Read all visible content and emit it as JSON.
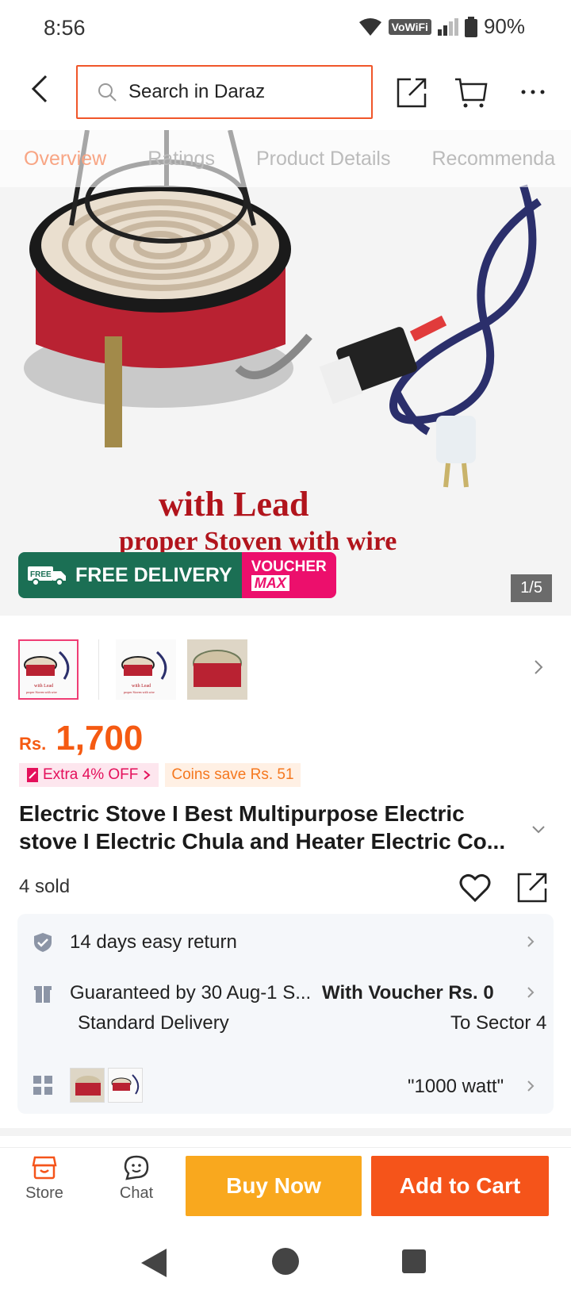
{
  "status": {
    "time": "8:56",
    "network": "VoWiFi",
    "battery": "90%"
  },
  "search": {
    "placeholder": "Search in Daraz"
  },
  "tabs": [
    "Overview",
    "Ratings",
    "Product Details",
    "Recommenda"
  ],
  "hero": {
    "caption_line1": "with Lead",
    "caption_line2": "proper Stoven with wire",
    "badge_delivery": "FREE DELIVERY",
    "badge_free": "FREE",
    "badge_voucher": "VOUCHER",
    "badge_max": "MAX",
    "image_counter": "1/5"
  },
  "thumbnail_captions": {
    "line1": "with Lead",
    "line2": "proper Stoven with wire"
  },
  "price": {
    "currency": "Rs.",
    "amount": "1,700"
  },
  "promos": {
    "extra_off": "Extra 4% OFF",
    "coins": "Coins save Rs. 51"
  },
  "product": {
    "title": "Electric Stove I Best Multipurpose Electric stove I Electric Chula and Heater Electric Co...",
    "sold": "4 sold"
  },
  "info": {
    "return": "14 days easy return",
    "guarantee": "Guaranteed by 30 Aug-1 S...",
    "voucher": "With Voucher Rs. 0",
    "delivery_type": "Standard Delivery",
    "destination": "To Sector 4",
    "variant": "\"1000 watt\""
  },
  "bottom_bar": {
    "store": "Store",
    "chat": "Chat",
    "buy_now": "Buy Now",
    "add_to_cart": "Add to Cart"
  },
  "colors": {
    "accent": "#f5541a",
    "buy_now": "#f9a81e",
    "voucher_green": "#16a99b",
    "delivery_badge": "#1b6f54",
    "voucher_badge": "#ec0f6c"
  }
}
